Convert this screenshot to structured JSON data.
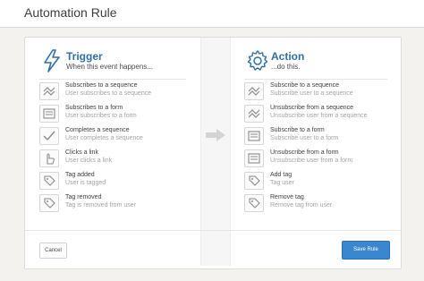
{
  "window": {
    "title": "Automation Rule"
  },
  "colors": {
    "accent": "#2f6fa8",
    "primary_button": "#3a86cf"
  },
  "trigger": {
    "title": "Trigger",
    "subtitle": "When this event happens...",
    "icon": "lightning-icon",
    "items": [
      {
        "icon": "sequence-icon",
        "title": "Subscribes to a sequence",
        "sub": "User subscribes to a sequence"
      },
      {
        "icon": "form-icon",
        "title": "Subscribes to a form",
        "sub": "User subscribes to a form"
      },
      {
        "icon": "checkmark-icon",
        "title": "Completes a sequence",
        "sub": "User completes a sequence"
      },
      {
        "icon": "pointer-hand-icon",
        "title": "Clicks a link",
        "sub": "User clicks a link"
      },
      {
        "icon": "tag-icon",
        "title": "Tag added",
        "sub": "User is tagged"
      },
      {
        "icon": "tag-icon",
        "title": "Tag removed",
        "sub": "Tag is removed from user"
      }
    ]
  },
  "action": {
    "title": "Action",
    "subtitle": "...do this.",
    "icon": "gear-icon",
    "items": [
      {
        "icon": "sequence-icon",
        "title": "Subscribe to a sequence",
        "sub": "Subscribe user to a sequence"
      },
      {
        "icon": "sequence-icon",
        "title": "Unsubscribe from a sequence",
        "sub": "Unsubscribe user from a sequence"
      },
      {
        "icon": "form-icon",
        "title": "Subscribe to a form",
        "sub": "Subscribe user to a form"
      },
      {
        "icon": "form-icon",
        "title": "Unsubscribe from a form",
        "sub": "Unsubscribe user from a form"
      },
      {
        "icon": "tag-icon",
        "title": "Add tag",
        "sub": "Tag user"
      },
      {
        "icon": "tag-icon",
        "title": "Remove tag",
        "sub": "Remove tag from user"
      }
    ]
  },
  "buttons": {
    "cancel": "Cancel",
    "save": "Save Rule"
  }
}
